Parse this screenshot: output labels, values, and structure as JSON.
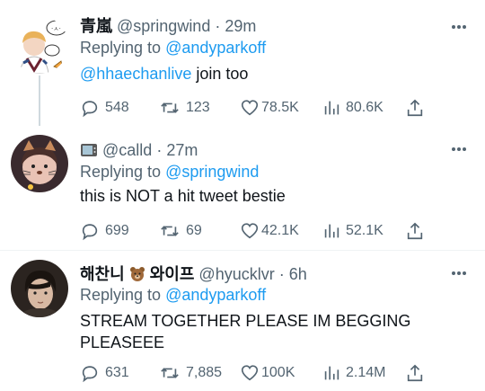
{
  "tweets": [
    {
      "name": "青嵐",
      "handle": "@springwind",
      "time": "· 29m",
      "reply_prefix": "Replying to",
      "reply_to": "@andyparkoff",
      "mention": "@hhaechanlive",
      "text": " join too",
      "replies": "548",
      "retweets": "123",
      "likes": "78.5K",
      "views": "80.6K"
    },
    {
      "name_emoji": "tv-icon",
      "handle": "@calld",
      "time": "· 27m",
      "reply_prefix": "Replying to",
      "reply_to": "@springwind",
      "text": "this is NOT a hit tweet bestie",
      "replies": "699",
      "retweets": "69",
      "likes": "42.1K",
      "views": "52.1K"
    },
    {
      "name": "해찬니",
      "name_emoji": "bear-icon",
      "name2": "와이프",
      "handle": "@hyucklvr",
      "time": "· 6h",
      "reply_prefix": "Replying to",
      "reply_to": "@andyparkoff",
      "text_line1": "STREAM TOGETHER PLEASE IM BEGGING",
      "text_line2": "PLEASEEE",
      "replies": "631",
      "retweets": "7,885",
      "likes": "100K",
      "views": "2.14M"
    }
  ],
  "colors": {
    "link": "#1d9bf0",
    "muted": "#536471",
    "text": "#0f1419"
  }
}
